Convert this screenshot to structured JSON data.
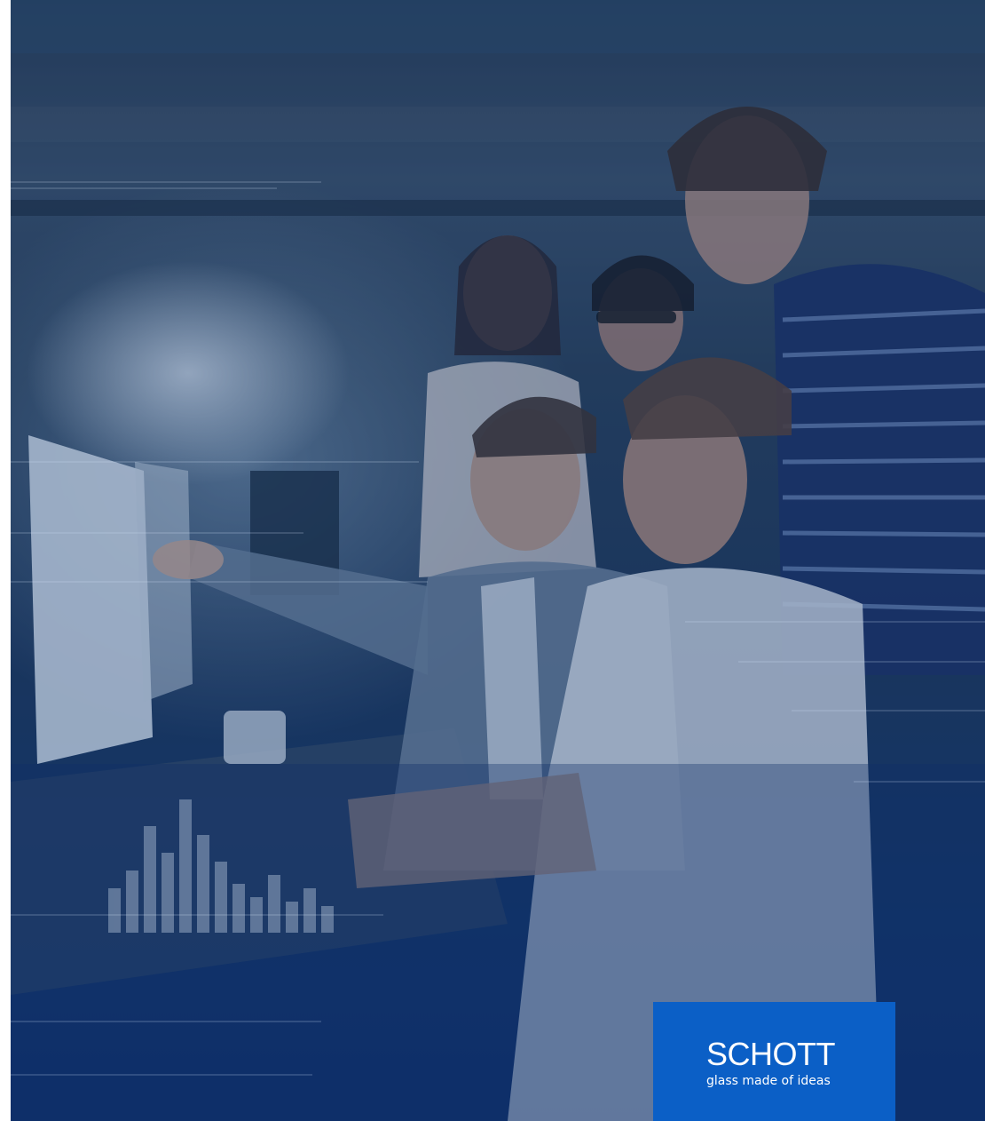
{
  "photo": {
    "subject": "team-looking-at-monitor",
    "tint": "#163a6e"
  },
  "brand": {
    "wordmark": "SCHOTT",
    "tagline": "glass made of ideas",
    "box_color": "#0b5fc6"
  }
}
